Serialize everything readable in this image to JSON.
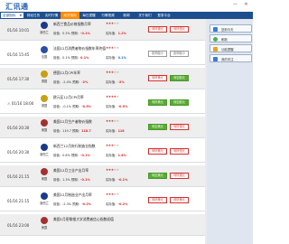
{
  "app": {
    "logo_text": "汇讯通",
    "minimize_label": "—",
    "close_label": "✕"
  },
  "nav": {
    "selector": "全部指标",
    "items": [
      "财经日历",
      "实时行情",
      "经济指标",
      "每日提醒",
      "行情视频",
      "新闻",
      "关于我们",
      "登录平台"
    ],
    "active_index": 2
  },
  "rows": [
    {
      "date": "01/16 10:01",
      "warn": false,
      "country": "新西兰",
      "flag_color": "#1b3a8a",
      "title": "新西兰食品价格指数月率",
      "previous": "前值：0.3%",
      "actual_label": "预期：",
      "actual": "-0.1%",
      "stars_on": 3,
      "forecast_label": "实际值：",
      "forecast": "1.2%",
      "forecast_blue": false,
      "btn1": "利好澳元",
      "btn1_style": "red",
      "btn2": "利好纽元",
      "btn2_style": "red"
    },
    {
      "date": "01/16 15:45",
      "warn": false,
      "country": "法国",
      "flag_color": "#2a4fa5",
      "title": "法国12月消费者物价指数年率终值",
      "previous": "前值：0.1%",
      "actual_label": "预期：",
      "actual": "0.1%",
      "stars_on": 3,
      "forecast_label": "实际值：",
      "forecast": "0.1%",
      "forecast_blue": true,
      "btn1": "影响较小",
      "btn1_style": "gray",
      "btn2": "影响较小",
      "btn2_style": "gray"
    },
    {
      "date": "01/16 17:30",
      "warn": false,
      "country": "德国",
      "flag_color": "#c8a016",
      "title": "德国12月CPI年率",
      "previous": "前值：-2.4%",
      "actual_label": "预期：",
      "actual": "-2%",
      "stars_on": 3,
      "forecast_label": "实际值：",
      "forecast": "-2%",
      "forecast_blue": false,
      "btn1": "利好美元",
      "btn1_style": "red",
      "btn2": "利空欧元",
      "btn2_style": "green"
    },
    {
      "date": "01/16 18:00",
      "warn": true,
      "country": "德国",
      "flag_color": "#c8a016",
      "title": "欧元区12月CPI月率",
      "previous": "前值：-0.1%",
      "actual_label": "预期：",
      "actual": "-0.5%",
      "stars_on": 4,
      "forecast_label": "实际值：",
      "forecast": "-0.5%",
      "forecast_blue": false,
      "btn1": "利好美元",
      "btn1_style": "green",
      "btn2": "利空欧元",
      "btn2_style": "green"
    },
    {
      "date": "01/16 20:30",
      "warn": false,
      "country": "美国",
      "flag_color": "#a33030",
      "title": "美国12月生产者物价指数",
      "previous": "前值：119.7",
      "actual_label": "预期：",
      "actual": "118.7",
      "stars_on": 3,
      "forecast_label": "实际值：",
      "forecast": "118",
      "forecast_blue": false,
      "btn1": "利空美元",
      "btn1_style": "green",
      "btn2": "利好澳元",
      "btn2_style": "red"
    },
    {
      "date": "01/16 20:30",
      "warn": false,
      "country": "新西兰",
      "flag_color": "#1b3a8a",
      "title": "新西兰12月央行制造业指数",
      "previous": "前值：0.8%",
      "actual_label": "预期：",
      "actual": "-0.1%",
      "stars_on": 3,
      "forecast_label": "实际值：",
      "forecast": "1.6%",
      "forecast_blue": false,
      "btn1": "利好美元",
      "btn1_style": "red",
      "btn2": "利好纽元",
      "btn2_style": "red"
    },
    {
      "date": "01/16 21:15",
      "warn": false,
      "country": "美国",
      "flag_color": "#a33030",
      "title": "美国12月工业产出月率",
      "previous": "前值：1.3%",
      "actual_label": "预期：",
      "actual": "-0.1%",
      "stars_on": 3,
      "forecast_label": "实际值：",
      "forecast": "-0.1%",
      "forecast_blue": false,
      "btn1": "利空美元",
      "btn1_style": "green",
      "btn2": "利好澳元",
      "btn2_style": "red"
    },
    {
      "date": "01/16 21:15",
      "warn": false,
      "country": "新西兰",
      "flag_color": "#1b3a8a",
      "title": "美国12月制造业产出月率",
      "previous": "前值：-2.3%",
      "actual_label": "预期：",
      "actual": "-0.2%",
      "stars_on": 3,
      "forecast_label": "实际值：",
      "forecast": "-0.2%",
      "forecast_blue": false,
      "btn1": "利好美元",
      "btn1_style": "red",
      "btn2": "利好美元",
      "btn2_style": "red"
    },
    {
      "date": "01/16 23:00",
      "warn": false,
      "country": "美国",
      "flag_color": "#a33030",
      "title": "美国1月密歇根大学消费者信心指数初值",
      "previous": "",
      "actual_label": "",
      "actual": "",
      "stars_on": 0,
      "forecast_label": "",
      "forecast": "",
      "forecast_blue": false,
      "btn1": "",
      "btn1_style": "red",
      "btn2": "",
      "btn2_style": "red"
    }
  ],
  "side": {
    "buttons": [
      {
        "label": "回到今天",
        "icon_color": "#3a7bd5"
      },
      {
        "label": "刷新",
        "icon_color": "#4caf50"
      },
      {
        "label": "功能提醒",
        "icon_color": "#f0a020"
      },
      {
        "label": "我的关注",
        "icon_color": "#3a7bd5"
      }
    ]
  }
}
